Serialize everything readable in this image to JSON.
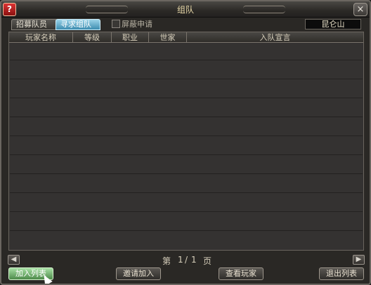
{
  "window": {
    "title": "组队",
    "corner_icon": "?",
    "close": "×"
  },
  "tabs": [
    {
      "label": "招募队员",
      "active": false
    },
    {
      "label": "寻求组队",
      "active": true
    }
  ],
  "filter": {
    "label": "屏蔽申请",
    "checked": false
  },
  "location": {
    "value": "昆仑山"
  },
  "table": {
    "headers": [
      "玩家名称",
      "等级",
      "职业",
      "世家",
      "入队宣言"
    ],
    "rows": []
  },
  "pager": {
    "label_prefix": "第",
    "current": "1",
    "sep": "/",
    "total": "1",
    "label_suffix": "页"
  },
  "buttons": [
    {
      "label": "加入列表",
      "active": true
    },
    {
      "label": "邀请加入",
      "active": false
    },
    {
      "label": "查看玩家",
      "active": false
    },
    {
      "label": "退出列表",
      "active": false
    }
  ],
  "icons": {
    "left": "left-arrow-icon",
    "right": "right-arrow-icon"
  }
}
